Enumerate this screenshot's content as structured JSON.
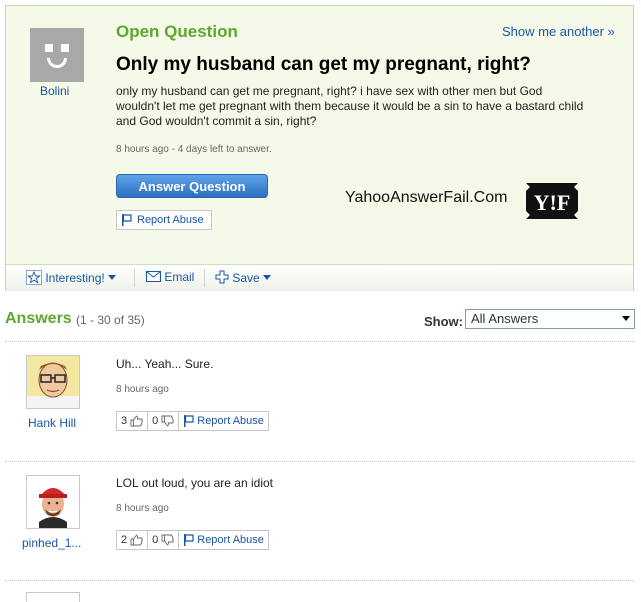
{
  "question": {
    "label": "Open Question",
    "show_another": "Show me another »",
    "asker": "Bolini",
    "title": "Only my husband can get my pregnant, right?",
    "body": "only my husband can get me pregnant, right? i have sex with other men but God wouldn't let me get pregnant with them because it would be a sin to have a bastard child and God wouldn't commit a sin, right?",
    "meta": "8 hours ago - 4 days left to answer.",
    "answer_button": "Answer Question",
    "report_abuse": "Report Abuse"
  },
  "watermark": {
    "text": "YahooAnswerFail.Com",
    "logo": "Y!F"
  },
  "toolbar": {
    "interesting": "Interesting!",
    "email": "Email",
    "save": "Save"
  },
  "answers_header": {
    "title": "Answers",
    "count": "(1 - 30 of 35)",
    "show_label": "Show:",
    "show_value": "All Answers"
  },
  "answers": [
    {
      "user": "Hank Hill",
      "text": "Uh... Yeah... Sure.",
      "time": "8 hours ago",
      "up": "3",
      "down": "0",
      "report": "Report Abuse"
    },
    {
      "user": "pinhed_1...",
      "text": "LOL out loud, you are an idiot",
      "time": "8 hours ago",
      "up": "2",
      "down": "0",
      "report": "Report Abuse"
    }
  ],
  "colors": {
    "accent_green": "#5da82c",
    "link_blue": "#1a56a8",
    "question_bg": "#f4f9e8"
  },
  "icons": [
    "star-icon",
    "envelope-icon",
    "plus-icon",
    "flag-icon",
    "thumbs-up-icon",
    "thumbs-down-icon",
    "chevron-down-icon"
  ]
}
